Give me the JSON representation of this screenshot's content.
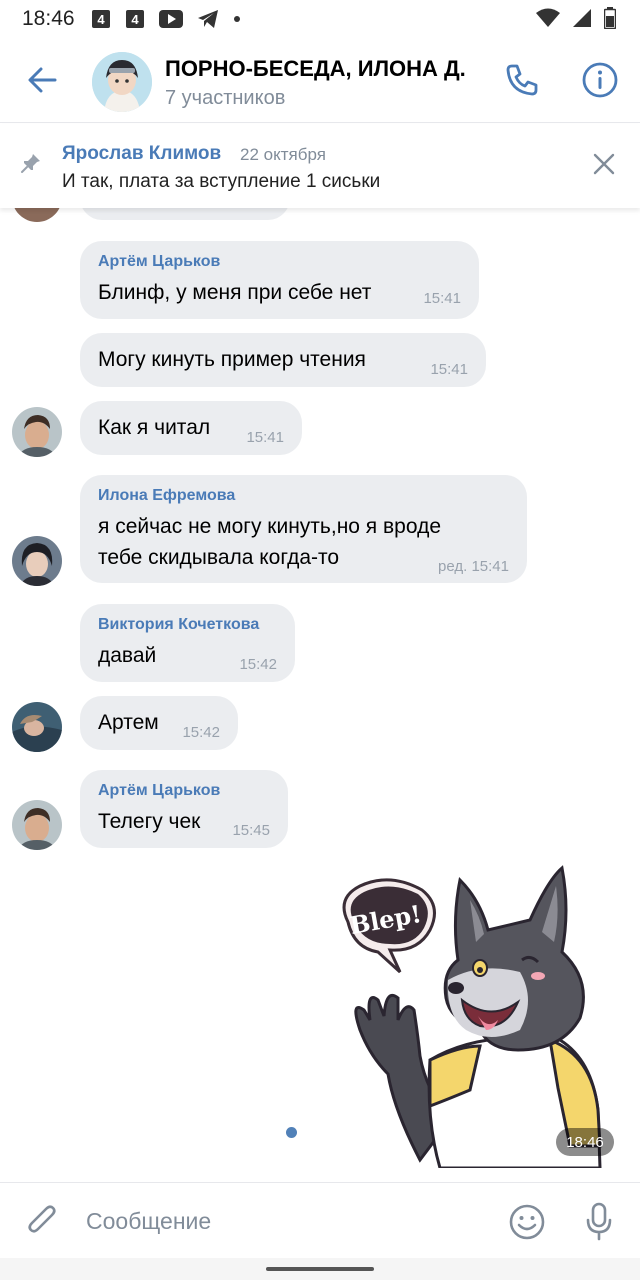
{
  "status_bar": {
    "time": "18:46",
    "icons": [
      "notification-4-icon",
      "notification-4-icon",
      "youtube-icon",
      "telegram-icon",
      "dot-icon"
    ],
    "right_icons": [
      "wifi-icon",
      "signal-icon",
      "battery-icon"
    ]
  },
  "header": {
    "title": "ПОРНО-БЕСЕДА, ИЛОНА Д.",
    "subtitle": "7 участников"
  },
  "pinned": {
    "author": "Ярослав Климов",
    "date": "22 октября",
    "text": "И так, плата за вступление 1 сиськи"
  },
  "messages": [
    {
      "author": "Артём Царьков",
      "text": "Блинф, у меня при себе нет",
      "time": "15:41"
    },
    {
      "author": "",
      "text": "Могу кинуть пример чтения",
      "time": "15:41"
    },
    {
      "author": "",
      "text": "Как я читал",
      "time": "15:41"
    },
    {
      "author": "Илона Ефремова",
      "text_line1": "я сейчас не могу кинуть,но я вроде",
      "text_line2": "тебе скидывала когда-то",
      "time": "ред. 15:41"
    },
    {
      "author": "Виктория Кочеткова",
      "text": "давай",
      "time": "15:42"
    },
    {
      "author": "",
      "text": "Артем",
      "time": "15:42"
    },
    {
      "author": "Артём Царьков",
      "text": "Телегу чек",
      "time": "15:45"
    }
  ],
  "sticker": {
    "bubble_text": "Blep!",
    "time": "18:46"
  },
  "composer": {
    "placeholder": "Сообщение"
  },
  "colors": {
    "accent": "#4a7bb7",
    "bubble": "#ebedf0",
    "secondary_text": "#818c99"
  }
}
